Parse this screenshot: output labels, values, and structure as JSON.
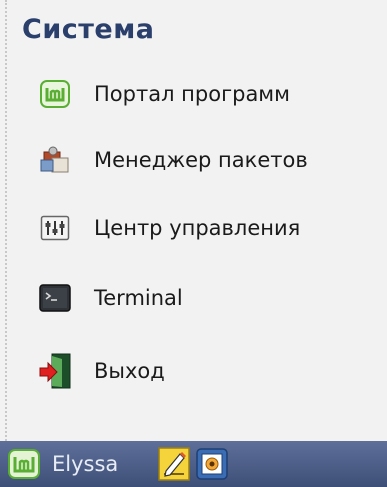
{
  "menu": {
    "section_title": "Система",
    "items": [
      {
        "label": "Портал программ",
        "icon": "mint-software-icon"
      },
      {
        "label": "Менеджер пакетов",
        "icon": "package-manager-icon"
      },
      {
        "label": "Центр управления",
        "icon": "control-center-icon"
      },
      {
        "label": "Terminal",
        "icon": "terminal-icon"
      },
      {
        "label": "Выход",
        "icon": "logout-icon"
      }
    ]
  },
  "taskbar": {
    "start_label": "Elyssa",
    "launchers": [
      "text-editor-icon",
      "screenshot-icon"
    ]
  },
  "colors": {
    "title": "#2a3f6b",
    "panel_bg": "#f2f2f2",
    "taskbar_top": "#5e6f9a",
    "taskbar_bottom": "#3e4f77",
    "mint_green": "#5aae34"
  }
}
